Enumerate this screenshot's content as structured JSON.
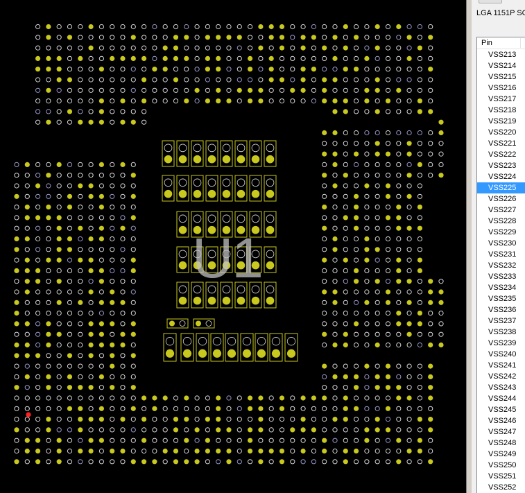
{
  "part_title": "LGA 1151P SC",
  "reference_designator": "U1",
  "pin_list": {
    "column_header": "Pin",
    "selected": "VSS225",
    "rows": [
      "VSS213",
      "VSS214",
      "VSS215",
      "VSS216",
      "VSS217",
      "VSS218",
      "VSS219",
      "VSS220",
      "VSS221",
      "VSS222",
      "VSS223",
      "VSS224",
      "VSS225",
      "VSS226",
      "VSS227",
      "VSS228",
      "VSS229",
      "VSS230",
      "VSS231",
      "VSS232",
      "VSS233",
      "VSS234",
      "VSS235",
      "VSS236",
      "VSS237",
      "VSS238",
      "VSS239",
      "VSS240",
      "VSS241",
      "VSS242",
      "VSS243",
      "VSS244",
      "VSS245",
      "VSS246",
      "VSS247",
      "VSS248",
      "VSS249",
      "VSS250",
      "VSS251",
      "VSS252"
    ]
  },
  "colors": {
    "background": "#000000",
    "pad_fill": "#c8c81e",
    "pad_outline": "#d8d8d8",
    "pad_outline_alt": "#9a9acc",
    "highlight_pin": "#ff2020",
    "component_outline": "#c8c81e",
    "selection": "#3399ff"
  },
  "icons": {
    "pad": "circle-pad",
    "smd_pad": "rect-pad"
  }
}
